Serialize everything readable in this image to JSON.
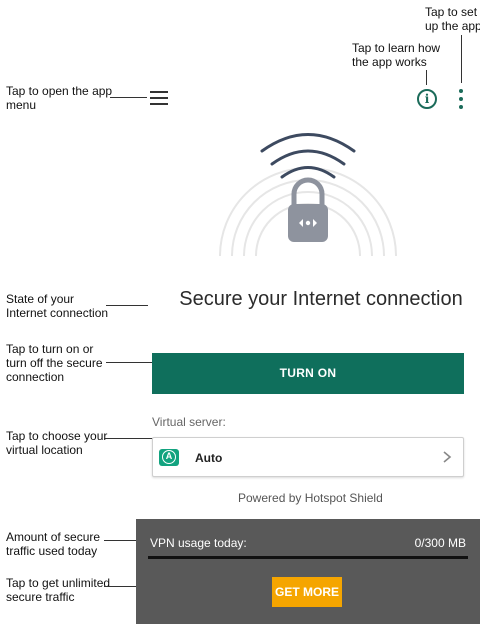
{
  "callouts": {
    "setup": "Tap to set\nup the app",
    "learn": "Tap to learn how\nthe app works",
    "menu": "Tap to open the app\nmenu",
    "state": "State of your\nInternet connection",
    "toggle": "Tap to turn on or\nturn off the secure\nconnection",
    "location": "Tap to choose your\nvirtual location",
    "traffic": "Amount of secure\ntraffic used today",
    "unlimited": "Tap to get unlimited\nsecure traffic"
  },
  "header": {
    "menu_icon": "hamburger-icon",
    "info_icon": "info-icon",
    "more_icon": "more-vertical-icon",
    "accent_color": "#1b6b5a"
  },
  "hero": {
    "icon": "lock-signal-icon"
  },
  "main": {
    "headline": "Secure your Internet connection",
    "turn_on_label": "TURN ON",
    "virtual_server_label": "Virtual server:",
    "server_value": "Auto",
    "server_icon": "auto-location-icon",
    "powered_by": "Powered by Hotspot Shield"
  },
  "usage": {
    "label": "VPN usage today:",
    "value": "0/300 MB",
    "used_mb": 0,
    "limit_mb": 300,
    "get_more_label": "GET MORE"
  },
  "colors": {
    "primary": "#0f6f5c",
    "badge": "#12a37f",
    "cta": "#f5a500",
    "panel": "#595959"
  }
}
